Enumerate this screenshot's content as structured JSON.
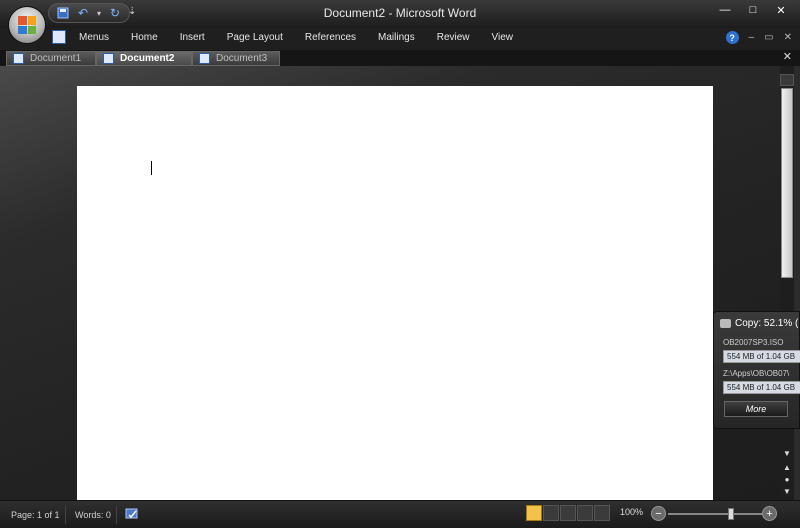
{
  "window": {
    "title": "Document2 - Microsoft Word"
  },
  "qat": {
    "more_glyph": "⇣"
  },
  "menus": [
    "Menus",
    "Home",
    "Insert",
    "Page Layout",
    "References",
    "Mailings",
    "Review",
    "View"
  ],
  "tabs": [
    {
      "label": "Document1",
      "active": false
    },
    {
      "label": "Document2",
      "active": true
    },
    {
      "label": "Document3",
      "active": false
    }
  ],
  "copy_dialog": {
    "title": "Copy: 52.1% (",
    "file_name": "OB2007SP3.ISO",
    "file_progress": "554 MB of 1.04 GB",
    "dest_path": "Z:\\Apps\\OB\\OB07\\",
    "total_progress": "554 MB of 1.04 GB",
    "more_label": "More",
    "percent": 52.1
  },
  "status": {
    "page": "Page: 1 of 1",
    "words": "Words: 0",
    "zoom_label": "100%",
    "zoom_level": 100
  }
}
